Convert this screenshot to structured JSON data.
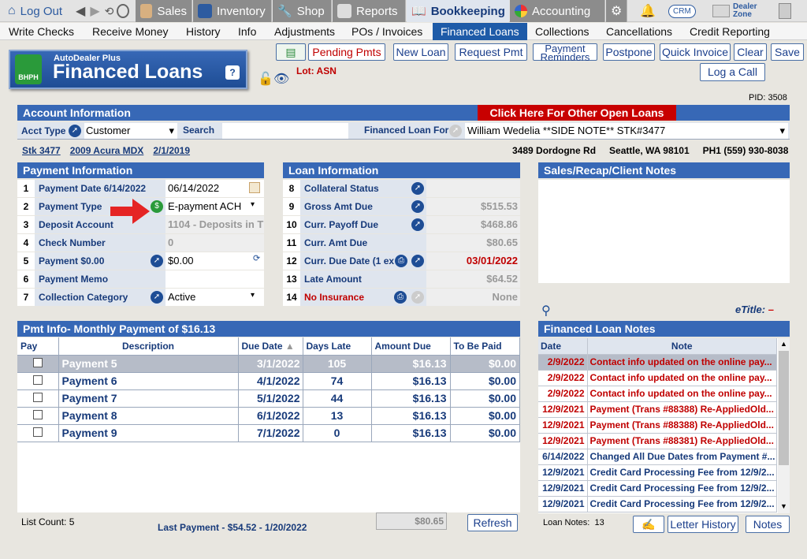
{
  "modules": {
    "logout": "Log Out",
    "sales": "Sales",
    "inventory": "Inventory",
    "shop": "Shop",
    "reports": "Reports",
    "bookkeeping": "Bookkeeping",
    "accounting": "Accounting",
    "crm": "CRM",
    "dealer_zone_1": "Dealer",
    "dealer_zone_2": "Zone"
  },
  "subnav": [
    "Write Checks",
    "Receive Money",
    "History",
    "Info",
    "Adjustments",
    "POs / Invoices",
    "Financed Loans",
    "Collections",
    "Cancellations",
    "Credit Reporting"
  ],
  "banner": {
    "small": "AutoDealer Plus",
    "title": "Financed Loans",
    "badge": "BHPH",
    "help": "?"
  },
  "lot": "Lot: ASN",
  "toolbar": {
    "pending": "Pending Pmts",
    "new_loan": "New Loan",
    "request_pmt": "Request Pmt",
    "payment_reminders_1": "Payment",
    "payment_reminders_2": "Reminders",
    "postpone": "Postpone",
    "quick_invoice": "Quick Invoice",
    "clear": "Clear",
    "save": "Save",
    "log_call": "Log a Call"
  },
  "pid": "PID: 3508",
  "account": {
    "header": "Account Information",
    "other_loans": "Click Here For Other Open Loans",
    "acct_type_label": "Acct Type",
    "acct_type_value": "Customer",
    "search_label": "Search",
    "search_value": "",
    "financed_for_label": "Financed Loan For",
    "financed_for_value": "William Wedelia **SIDE NOTE** STK#3477",
    "stock": "Stk 3477",
    "vehicle": "2009 Acura MDX",
    "date": "2/1/2019",
    "address": "3489 Dordogne Rd",
    "city": "Seattle, WA 98101",
    "phone": "PH1 (559) 930-8038"
  },
  "payment_info": {
    "header": "Payment Information",
    "rows": [
      {
        "n": "1",
        "label": "Payment Date  6/14/2022",
        "value": "06/14/2022"
      },
      {
        "n": "2",
        "label": "Payment Type",
        "value": "E-payment ACH"
      },
      {
        "n": "3",
        "label": "Deposit Account",
        "value": "1104 - Deposits in T"
      },
      {
        "n": "4",
        "label": "Check Number",
        "value": "0"
      },
      {
        "n": "5",
        "label": "Payment  $0.00",
        "value": "$0.00"
      },
      {
        "n": "6",
        "label": "Payment Memo",
        "value": ""
      },
      {
        "n": "7",
        "label": "Collection Category",
        "value": "Active"
      }
    ]
  },
  "loan_info": {
    "header": "Loan Information",
    "rows": [
      {
        "n": "8",
        "label": "Collateral Status",
        "value": ""
      },
      {
        "n": "9",
        "label": "Gross Amt Due",
        "value": "$515.53"
      },
      {
        "n": "10",
        "label": "Curr. Payoff Due",
        "value": "$468.86"
      },
      {
        "n": "11",
        "label": "Curr. Amt Due",
        "value": "$80.65"
      },
      {
        "n": "12",
        "label": "Curr. Due Date (1 ex",
        "value": "03/01/2022"
      },
      {
        "n": "13",
        "label": "Late Amount",
        "value": "$64.52"
      },
      {
        "n": "14",
        "label": "No Insurance",
        "value": "None"
      }
    ]
  },
  "sales_notes": {
    "header": "Sales/Recap/Client Notes",
    "etitle": "eTitle:",
    "etitle_value": "–"
  },
  "pmt_table": {
    "header": "Pmt Info- Monthly Payment of $16.13",
    "columns": [
      "Pay",
      "Description",
      "Due Date",
      "Days Late",
      "Amount Due",
      "To Be Paid"
    ],
    "rows": [
      [
        "Payment 5",
        "3/1/2022",
        "105",
        "$16.13",
        "$0.00"
      ],
      [
        "Payment 6",
        "4/1/2022",
        "74",
        "$16.13",
        "$0.00"
      ],
      [
        "Payment 7",
        "5/1/2022",
        "44",
        "$16.13",
        "$0.00"
      ],
      [
        "Payment 8",
        "6/1/2022",
        "13",
        "$16.13",
        "$0.00"
      ],
      [
        "Payment 9",
        "7/1/2022",
        "0",
        "$16.13",
        "$0.00"
      ]
    ],
    "list_count": "List Count:  5",
    "last_payment": "Last Payment - $54.52 - 1/20/2022",
    "total": "$80.65",
    "refresh": "Refresh"
  },
  "loan_notes": {
    "header": "Financed Loan Notes",
    "columns": [
      "Date",
      "Note"
    ],
    "rows": [
      {
        "date": "2/9/2022",
        "note": "Contact info updated on the online pay...",
        "red": true
      },
      {
        "date": "2/9/2022",
        "note": "Contact info updated on the online pay...",
        "red": true
      },
      {
        "date": "2/9/2022",
        "note": "Contact info updated on the online pay...",
        "red": true
      },
      {
        "date": "12/9/2021",
        "note": "Payment (Trans #88388) Re-AppliedOld...",
        "red": true
      },
      {
        "date": "12/9/2021",
        "note": "Payment (Trans #88388) Re-AppliedOld...",
        "red": true
      },
      {
        "date": "12/9/2021",
        "note": "Payment (Trans #88381) Re-AppliedOld...",
        "red": true
      },
      {
        "date": "6/14/2022",
        "note": "Changed All Due Dates from Payment #...",
        "red": false
      },
      {
        "date": "12/9/2021",
        "note": "Credit Card Processing Fee from 12/9/2...",
        "red": false
      },
      {
        "date": "12/9/2021",
        "note": "Credit Card Processing Fee from 12/9/2...",
        "red": false
      },
      {
        "date": "12/9/2021",
        "note": "Credit Card Processing Fee from 12/9/2...",
        "red": false
      }
    ],
    "count_label": "Loan Notes:",
    "count": "13",
    "letter_history": "Letter History",
    "notes_btn": "Notes"
  },
  "colors": {
    "header": "#3768b6",
    "label_bg": "#dfe5ee",
    "accent_red": "#c00000"
  }
}
